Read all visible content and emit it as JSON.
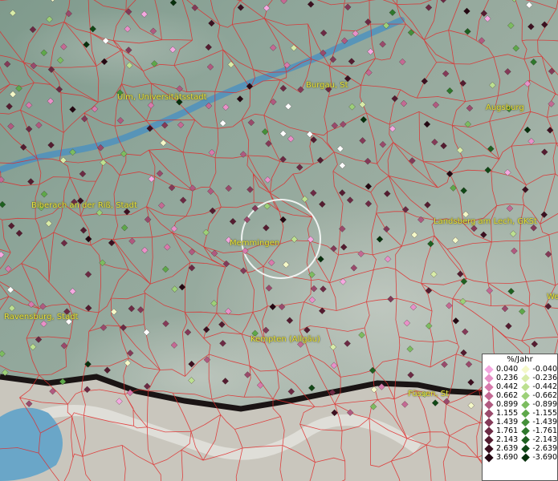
{
  "legend": {
    "title": "%/Jahr",
    "positive": [
      {
        "label": "0.040",
        "color": "#f4a8e0"
      },
      {
        "label": "0.236",
        "color": "#e890c8"
      },
      {
        "label": "0.442",
        "color": "#d87aac"
      },
      {
        "label": "0.662",
        "color": "#c46a94"
      },
      {
        "label": "0.899",
        "color": "#b05a80"
      },
      {
        "label": "1.155",
        "color": "#9a4a6c"
      },
      {
        "label": "1.439",
        "color": "#843a58"
      },
      {
        "label": "1.761",
        "color": "#6c2a44"
      },
      {
        "label": "2.143",
        "color": "#541c30"
      },
      {
        "label": "2.639",
        "color": "#3c1020"
      },
      {
        "label": "3.690",
        "color": "#240812"
      }
    ],
    "negative": [
      {
        "label": "-0.040",
        "color": "#f4f8c8"
      },
      {
        "label": "-0.236",
        "color": "#d8eca8"
      },
      {
        "label": "-0.442",
        "color": "#bce090"
      },
      {
        "label": "-0.662",
        "color": "#9cd078"
      },
      {
        "label": "-0.899",
        "color": "#7cbc60"
      },
      {
        "label": "-1.155",
        "color": "#5ea84a"
      },
      {
        "label": "-1.439",
        "color": "#44903a"
      },
      {
        "label": "-1.761",
        "color": "#2e782c"
      },
      {
        "label": "-2.143",
        "color": "#1e6020"
      },
      {
        "label": "-2.639",
        "color": "#104816"
      },
      {
        "label": "-3.690",
        "color": "#06300c"
      }
    ]
  },
  "cities": [
    {
      "id": "ulm",
      "name": "Ulm, Universitätsstadt"
    },
    {
      "id": "burgau",
      "name": "Burgau, St"
    },
    {
      "id": "augsburg",
      "name": "Augsburg"
    },
    {
      "id": "biberach",
      "name": "Biberach an der Riß, Stadt"
    },
    {
      "id": "landsberg",
      "name": "Landsberg am Lech, GKSt"
    },
    {
      "id": "memmingen",
      "name": "Memmingen"
    },
    {
      "id": "ravensburg",
      "name": "Ravensburg, Stadt"
    },
    {
      "id": "kempten",
      "name": "Kempten (Allgäu)"
    },
    {
      "id": "fussen",
      "name": "Füssen, St"
    },
    {
      "id": "we",
      "name": "We"
    }
  ]
}
